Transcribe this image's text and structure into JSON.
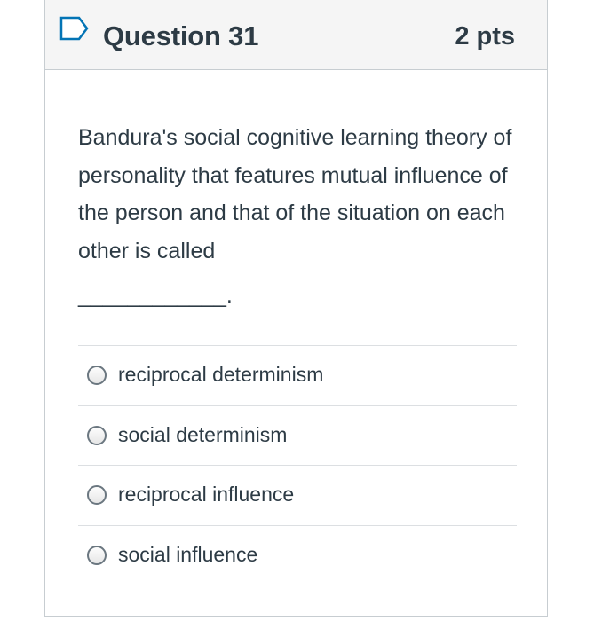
{
  "question": {
    "title": "Question 31",
    "points": "2 pts",
    "text": "Bandura's social cognitive learning theory of personality that features mutual influence of the person and that of the situation on each other is called",
    "blank": "____________.",
    "answers": [
      {
        "label": "reciprocal determinism"
      },
      {
        "label": "social determinism"
      },
      {
        "label": "reciprocal influence"
      },
      {
        "label": "social influence"
      }
    ]
  },
  "colors": {
    "header_bg": "#f5f5f5",
    "border": "#c7cdd1",
    "text": "#2d3b45",
    "flag_outline": "#0374b5"
  },
  "icons": {
    "flag": "flag-question-icon"
  }
}
